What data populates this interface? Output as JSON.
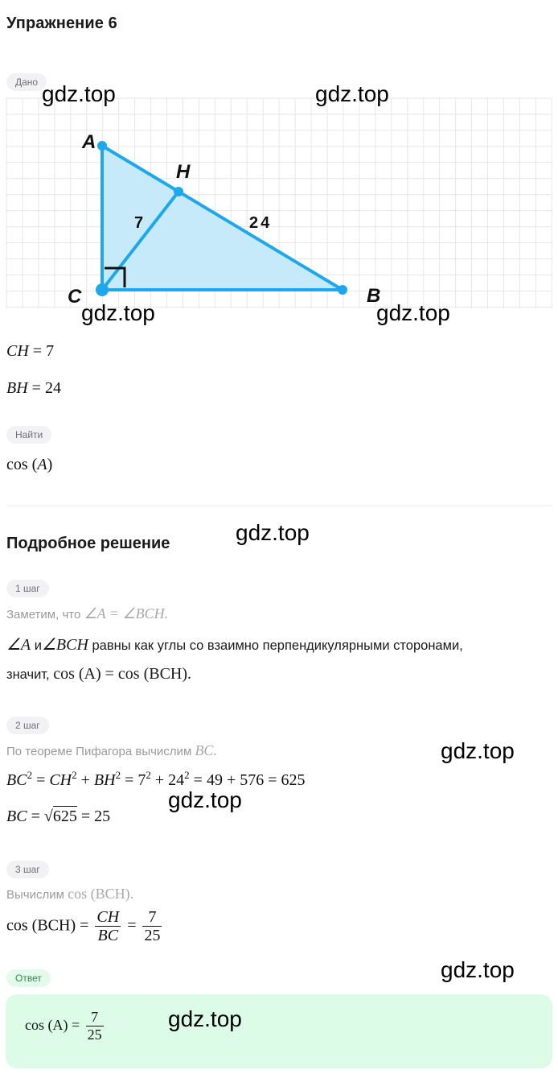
{
  "page": {
    "title": "Упражнение 6",
    "given_badge": "Дано",
    "find_badge": "Найти",
    "solution_heading": "Подробное решение",
    "answer_badge": "Ответ"
  },
  "figure": {
    "vertices": {
      "A": "A",
      "B": "B",
      "C": "C",
      "H": "H"
    },
    "segment_labels": {
      "CH": "7",
      "BH": "24"
    },
    "right_angle_at": "C",
    "colors": {
      "stroke": "#1ea7ec",
      "fill": "#c6eaf9",
      "grid": "#e6e6e6"
    }
  },
  "given": [
    {
      "lhs": "CH",
      "rhs": "7"
    },
    {
      "lhs": "BH",
      "rhs": "24"
    }
  ],
  "find": {
    "func": "cos",
    "arg": "A"
  },
  "steps": [
    {
      "badge": "1 шаг",
      "hint_text": "Заметим, что",
      "hint_math": "∠A = ∠BCH.",
      "line1_math_a": "∠A",
      "line1_and": "и",
      "line1_math_b": "∠BCH",
      "line1_text": "равны как углы со взаимно перпендикулярными сторонами,",
      "line2_text": "значит,",
      "line2_math": "cos (A) = cos (BCH)."
    },
    {
      "badge": "2 шаг",
      "hint_text": "По теореме Пифагора вычислим",
      "hint_math": "BC.",
      "eq1": {
        "lhs": "BC",
        "parts": [
          "CH",
          "BH",
          "7",
          "24"
        ],
        "sum": "49 + 576 = 625"
      },
      "eq2": {
        "lhs": "BC",
        "radicand": "625",
        "result": "25"
      }
    },
    {
      "badge": "3 шаг",
      "hint_text": "Вычислим",
      "hint_math": "cos (BCH).",
      "eq": {
        "lhs": "cos (BCH)",
        "frac1_num": "CH",
        "frac1_den": "BC",
        "frac2_num": "7",
        "frac2_den": "25"
      }
    }
  ],
  "answer": {
    "lhs": "cos (A)",
    "num": "7",
    "den": "25"
  },
  "watermarks": [
    "gdz.top",
    "gdz.top",
    "gdz.top",
    "gdz.top",
    "gdz.top",
    "gdz.top",
    "gdz.top",
    "gdz.top",
    "gdz.top"
  ],
  "colors": {
    "badge_bg": "#f2f2f4",
    "answer_bg": "#dcfce8",
    "answer_badge_text": "#2f8a51"
  }
}
